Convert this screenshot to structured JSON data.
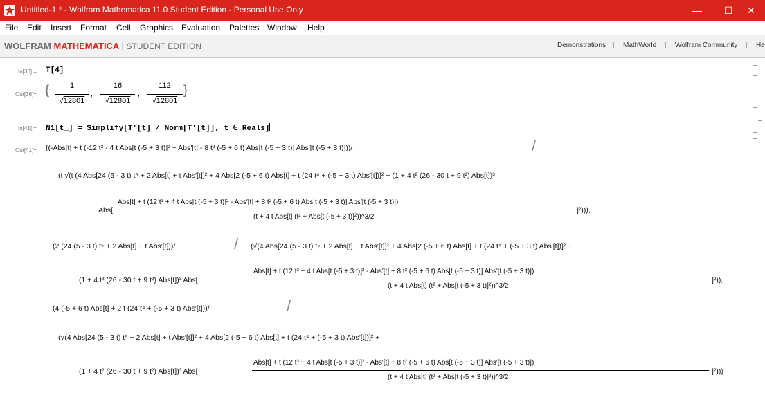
{
  "window": {
    "title": "Untitled-1 * - Wolfram Mathematica 11.0 Student Edition - Personal Use Only",
    "minimize": "—",
    "maximize": "☐",
    "close": "✕"
  },
  "menu": [
    "File",
    "Edit",
    "Insert",
    "Format",
    "Cell",
    "Graphics",
    "Evaluation",
    "Palettes",
    "Window",
    "Help"
  ],
  "brand": {
    "wolfram": "WOLFRAM",
    "mathematica": "MATHEMATICA",
    "separator": "|",
    "edition": "STUDENT EDITION",
    "links": [
      "Demonstrations",
      "MathWorld",
      "Wolfram Community",
      "He"
    ]
  },
  "cells": {
    "in36_label": "In[36]:=",
    "in36_text": "T[4]",
    "out36_label": "Out[36]=",
    "out36_nums": [
      "1",
      "16",
      "112"
    ],
    "out36_den": "12801",
    "in41_label": "In[41]:=",
    "in41_text": "N1[t_] = Simplify[T'[t] / Norm[T'[t]], t ∈ Reals]",
    "out41_label": "Out[41]=",
    "out41_lines": [
      "{(-Abs[t] + t (-12 t³ - 4 t Abs[t (-5 + 3 t)]² + Abs′[t] - 8 t² (-5 + 6 t) Abs[t (-5 + 3 t)] Abs′[t (-5 + 3 t)]))/",
      "(t √(t (4 Abs[24 (5 - 3 t) t⁵ + 2 Abs[t] + t Abs′[t]]² + 4 Abs[2 (-5 + 6 t) Abs[t] + t (24 t⁴ + (-5 + 3 t) Abs′[t])]² + (1 + 4 t² (26 - 30 t + 9 t²) Abs[t])³",
      "Abs[",
      "Abs[t] + t (12 t³ + 4 t Abs[t (-5 + 3 t)]² - Abs′[t] + 8 t² (-5 + 6 t) Abs[t (-5 + 3 t)] Abs′[t (-5 + 3 t)])",
      "(t + 4 t Abs[t] (t² + Abs[t (-5 + 3 t)]²))^3/2",
      "]²))),",
      "(2 (24 (5 - 3 t) t⁵ + 2 Abs[t] + t Abs′[t]))/",
      "(√(4 Abs[24 (5 - 3 t) t⁵ + 2 Abs[t] + t Abs′[t]]² + 4 Abs[2 (-5 + 6 t) Abs[t] + t (24 t⁴ + (-5 + 3 t) Abs′[t])]² +",
      "(1 + 4 t² (26 - 30 t + 9 t²) Abs[t])³ Abs[",
      "Abs[t] + t (12 t³ + 4 t Abs[t (-5 + 3 t)]² - Abs′[t] + 8 t² (-5 + 6 t) Abs[t (-5 + 3 t)] Abs′[t (-5 + 3 t)])",
      "(t + 4 t Abs[t] (t² + Abs[t (-5 + 3 t)]²))^3/2",
      "]²)),",
      "(4 (-5 + 6 t) Abs[t] + 2 t (24 t⁴ + (-5 + 3 t) Abs′[t]))/",
      "(√(4 Abs[24 (5 - 3 t) t⁵ + 2 Abs[t] + t Abs′[t]]² + 4 Abs[2 (-5 + 6 t) Abs[t] + t (24 t⁴ + (-5 + 3 t) Abs′[t])]² +",
      "(1 + 4 t² (26 - 30 t + 9 t²) Abs[t])³ Abs[",
      "Abs[t] + t (12 t³ + 4 t Abs[t (-5 + 3 t)]² - Abs′[t] + 8 t² (-5 + 6 t) Abs[t (-5 + 3 t)] Abs′[t (-5 + 3 t)])",
      "(t + 4 t Abs[t] (t² + Abs[t (-5 + 3 t)]²))^3/2",
      "]²))}"
    ]
  },
  "colors": {
    "titlebar": "#d9251c",
    "brand_red": "#d9251c"
  }
}
